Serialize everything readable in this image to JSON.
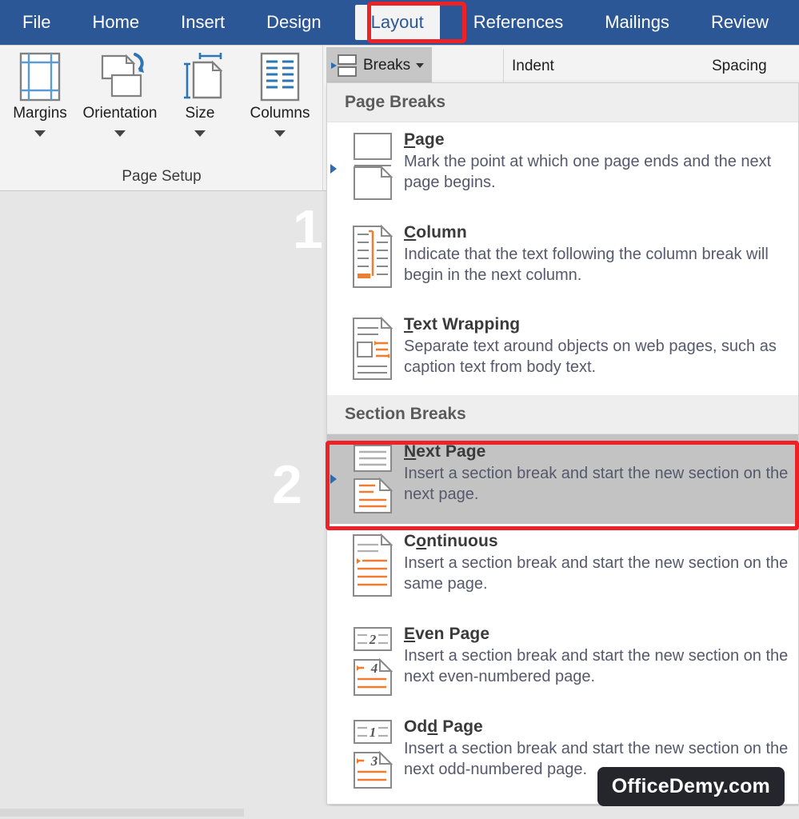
{
  "ribbon": {
    "tabs": [
      {
        "label": "File",
        "active": false
      },
      {
        "label": "Home",
        "active": false
      },
      {
        "label": "Insert",
        "active": false
      },
      {
        "label": "Design",
        "active": false
      },
      {
        "label": "Layout",
        "active": true
      },
      {
        "label": "References",
        "active": false
      },
      {
        "label": "Mailings",
        "active": false
      },
      {
        "label": "Review",
        "active": false
      }
    ],
    "page_setup": {
      "group_title": "Page Setup",
      "buttons": [
        {
          "label": "Margins",
          "icon": "margins-icon"
        },
        {
          "label": "Orientation",
          "icon": "orientation-icon"
        },
        {
          "label": "Size",
          "icon": "page-size-icon"
        },
        {
          "label": "Columns",
          "icon": "columns-icon"
        }
      ]
    },
    "breaks_button": {
      "label": "Breaks",
      "icon": "breaks-icon"
    },
    "column_headers": [
      {
        "label": "Indent"
      },
      {
        "label": "Spacing"
      }
    ]
  },
  "menu": {
    "sections": [
      {
        "header": "Page Breaks",
        "items": [
          {
            "title_pre": "",
            "title_accel": "P",
            "title_post": "age",
            "desc": "Mark the point at which one page ends and the next page begins.",
            "icon": "page-break-icon",
            "selected": false,
            "marker": true
          },
          {
            "title_pre": "",
            "title_accel": "C",
            "title_post": "olumn",
            "desc": "Indicate that the text following the column break will begin in the next column.",
            "icon": "column-break-icon",
            "selected": false,
            "marker": false
          },
          {
            "title_pre": "",
            "title_accel": "T",
            "title_post": "ext Wrapping",
            "desc": "Separate text around objects on web pages, such as caption text from body text.",
            "icon": "text-wrapping-break-icon",
            "selected": false,
            "marker": false
          }
        ]
      },
      {
        "header": "Section Breaks",
        "items": [
          {
            "title_pre": "",
            "title_accel": "N",
            "title_post": "ext Page",
            "desc": "Insert a section break and start the new section on the next page.",
            "icon": "next-page-break-icon",
            "selected": true,
            "marker": true
          },
          {
            "title_pre": "C",
            "title_accel": "o",
            "title_post": "ntinuous",
            "desc": "Insert a section break and start the new section on the same page.",
            "icon": "continuous-break-icon",
            "selected": false,
            "marker": false
          },
          {
            "title_pre": "",
            "title_accel": "E",
            "title_post": "ven Page",
            "desc": "Insert a section break and start the new section on the next even-numbered page.",
            "icon": "even-page-break-icon",
            "selected": false,
            "marker": false
          },
          {
            "title_pre": "Od",
            "title_accel": "d",
            "title_post": " Page",
            "desc": "Insert a section break and start the new section on the next odd-numbered page.",
            "icon": "odd-page-break-icon",
            "selected": false,
            "marker": false
          }
        ]
      }
    ]
  },
  "annotations": {
    "step_one": "1",
    "step_two": "2"
  },
  "watermark": {
    "text": "OfficeDemy.com"
  },
  "colors": {
    "ribbon_blue": "#2b5797",
    "annotation_red": "#ec2227",
    "selected_gray": "#c3c3c3",
    "icon_orange": "#ed7d31",
    "desc_text": "#55596b"
  }
}
